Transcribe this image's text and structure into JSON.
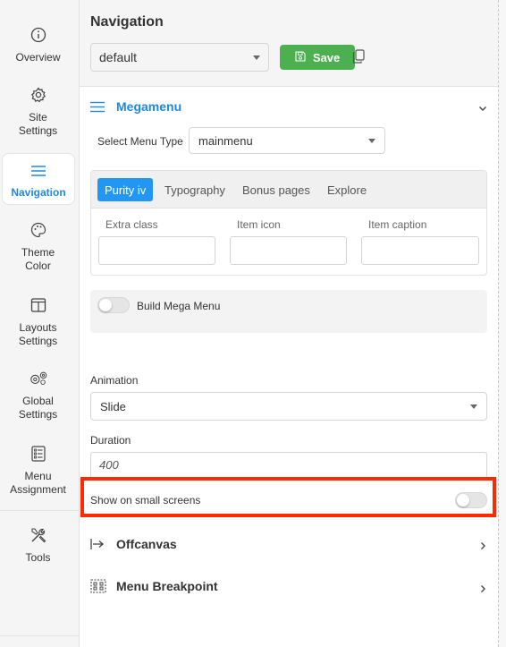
{
  "sidebar": {
    "items": [
      {
        "label": "Overview",
        "icon": "info-icon"
      },
      {
        "label": "Site\nSettings",
        "icon": "gear-icon"
      },
      {
        "label": "Navigation",
        "icon": "menu-icon",
        "active": true
      },
      {
        "label": "Theme\nColor",
        "icon": "palette-icon"
      },
      {
        "label": "Layouts\nSettings",
        "icon": "layout-icon"
      },
      {
        "label": "Global\nSettings",
        "icon": "gears-icon"
      },
      {
        "label": "Menu\nAssignment",
        "icon": "list-icon"
      },
      {
        "label": "Tools",
        "icon": "tools-icon"
      }
    ]
  },
  "header": {
    "title": "Navigation",
    "preset_value": "default",
    "save_label": "Save"
  },
  "megamenu": {
    "title": "Megamenu",
    "menu_type_label": "Select Menu Type",
    "menu_type_value": "mainmenu",
    "tabs": [
      "Purity iv",
      "Typography",
      "Bonus pages",
      "Explore"
    ],
    "fields": [
      "Extra class",
      "Item icon",
      "Item caption"
    ],
    "build_label": "Build Mega Menu",
    "animation_label": "Animation",
    "animation_value": "Slide",
    "duration_label": "Duration",
    "duration_value": "400",
    "small_screens_label": "Show on small screens"
  },
  "sections": {
    "offcanvas": "Offcanvas",
    "breakpoint": "Menu Breakpoint"
  },
  "colors": {
    "accent": "#1e88e5",
    "save_green": "#4caf50",
    "highlight": "#ff2a00"
  }
}
